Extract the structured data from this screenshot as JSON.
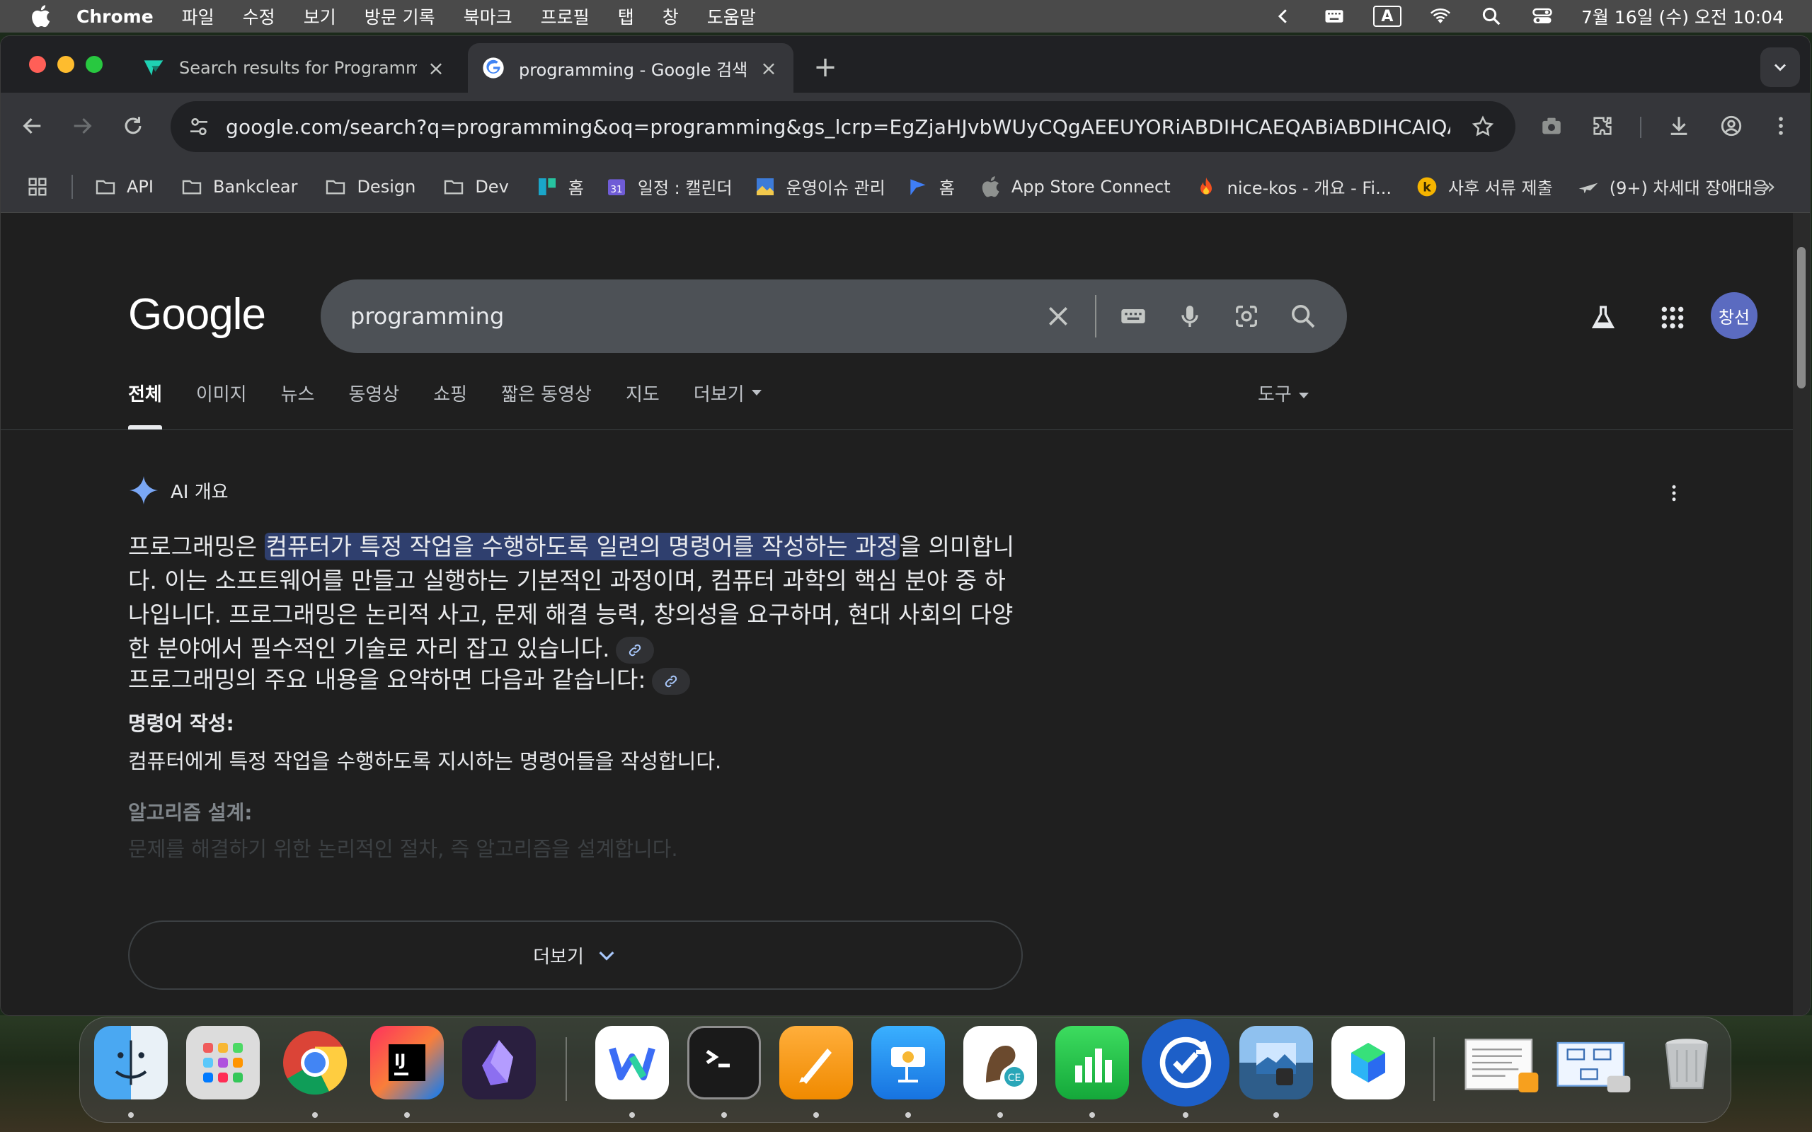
{
  "menubar": {
    "app_name": "Chrome",
    "menus": [
      "파일",
      "수정",
      "보기",
      "방문 기록",
      "북마크",
      "프로필",
      "탭",
      "창",
      "도움말"
    ],
    "input_indicator": "A",
    "clock": "7월 16일 (수) 오전 10:04"
  },
  "tabs": [
    {
      "title": "Search results for Programmi",
      "close": "×"
    },
    {
      "title": "programming - Google 검색",
      "close": "×"
    }
  ],
  "new_tab": "+",
  "omnibox": {
    "url": "google.com/search?q=programming&oq=programming&gs_lcrp=EgZjaHJvbWUyCQgAEEUYORiABDIHCAEQABiABDIHCAIQABiAB..."
  },
  "bookmarks": [
    {
      "label": "API",
      "icon": "folder-icon"
    },
    {
      "label": "Bankclear",
      "icon": "folder-icon"
    },
    {
      "label": "Design",
      "icon": "folder-icon"
    },
    {
      "label": "Dev",
      "icon": "folder-icon"
    },
    {
      "label": "홈",
      "icon": "board-icon"
    },
    {
      "label": "일정 : 캘린더",
      "icon": "calendar-icon"
    },
    {
      "label": "운영이슈 관리",
      "icon": "image-icon"
    },
    {
      "label": "홈",
      "icon": "flag-icon"
    },
    {
      "label": "App Store Connect",
      "icon": "apple-icon"
    },
    {
      "label": "nice-kos - 개요 - Fi...",
      "icon": "flame-icon"
    },
    {
      "label": "사후 서류 제출",
      "icon": "k-icon"
    },
    {
      "label": "(9+) 차세대 장애대응",
      "icon": "plane-icon"
    }
  ],
  "bookmarks_more": "»",
  "google": {
    "logo": "Google",
    "query": "programming",
    "avatar_text": "창선",
    "nav": [
      "전체",
      "이미지",
      "뉴스",
      "동영상",
      "쇼핑",
      "짧은 동영상",
      "지도",
      "더보기"
    ],
    "tools": "도구"
  },
  "ai_overview": {
    "heading": "AI 개요",
    "para_before": "프로그래밍은 ",
    "para_highlight": "컴퓨터가 특정 작업을 수행하도록 일련의 명령어를 작성하는 과정",
    "para_after": "을 의미합니다. 이는 소프트웨어를 만들고 실행하는 기본적인 과정이며, 컴퓨터 과학의 핵심 분야 중 하나입니다. 프로그래밍은 논리적 사고, 문제 해결 능력, 창의성을 요구하며, 현대 사회의 다양한 분야에서 필수적인 기술로 자리 잡고 있습니다.",
    "summary_line": "프로그래밍의 주요 내용을 요약하면 다음과 같습니다:",
    "item1_title": "명령어 작성:",
    "item1_text": "컴퓨터에게 특정 작업을 수행하도록 지시하는 명령어들을 작성합니다.",
    "item2_title": "알고리즘 설계:",
    "item2_text": "문제를 해결하기 위한 논리적인 절차, 즉 알고리즘을 설계합니다.",
    "show_more": "더보기"
  },
  "colors": {
    "page_bg": "#1f1f1f",
    "highlight_bg": "#2f3f6e",
    "avatar_bg": "#5b6bc0"
  }
}
